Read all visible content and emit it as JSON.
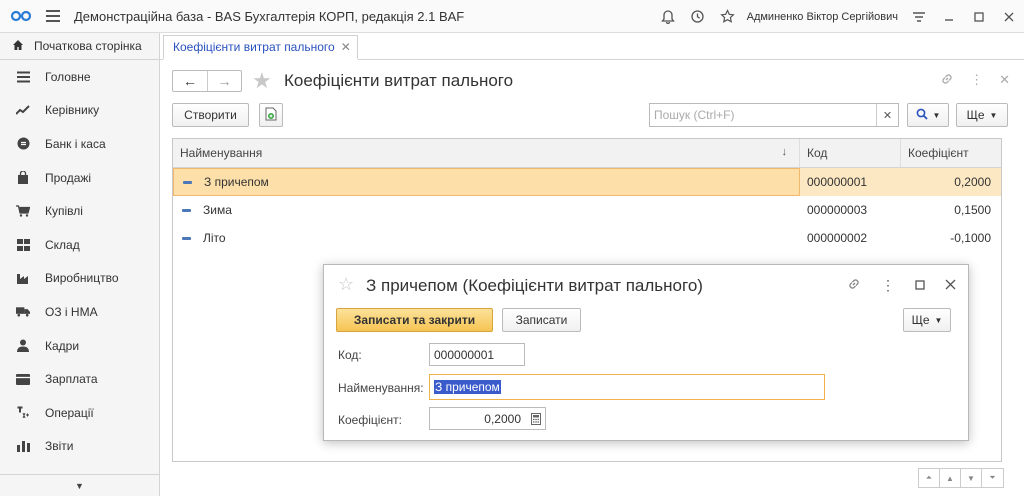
{
  "app": {
    "title": "Демонстраційна база - BAS Бухгалтерія КОРП, редакція 2.1 BAF",
    "user": "Админенко Віктор Сергійович"
  },
  "tabs": {
    "home": "Початкова сторінка",
    "active": "Коефіцієнти витрат пального"
  },
  "sidebar": {
    "items": [
      {
        "label": "Головне",
        "icon": "menu-lines-icon"
      },
      {
        "label": "Керівнику",
        "icon": "chart-trend-icon"
      },
      {
        "label": "Банк і каса",
        "icon": "coin-icon"
      },
      {
        "label": "Продажі",
        "icon": "shopping-bag-icon"
      },
      {
        "label": "Купівлі",
        "icon": "cart-icon"
      },
      {
        "label": "Склад",
        "icon": "warehouse-grid-icon"
      },
      {
        "label": "Виробництво",
        "icon": "factory-icon"
      },
      {
        "label": "ОЗ і НМА",
        "icon": "truck-icon"
      },
      {
        "label": "Кадри",
        "icon": "person-icon"
      },
      {
        "label": "Зарплата",
        "icon": "wallet-icon"
      },
      {
        "label": "Операції",
        "icon": "operations-icon"
      },
      {
        "label": "Звіти",
        "icon": "bar-chart-icon"
      }
    ]
  },
  "list": {
    "title": "Коефіцієнти витрат пального",
    "create_label": "Створити",
    "search_placeholder": "Пошук (Ctrl+F)",
    "more_label": "Ще",
    "columns": [
      "Найменування",
      "Код",
      "Коефіцієнт"
    ],
    "rows": [
      {
        "name": "З причепом",
        "code": "000000001",
        "coef": "0,2000",
        "selected": true
      },
      {
        "name": "Зима",
        "code": "000000003",
        "coef": "0,1500"
      },
      {
        "name": "Літо",
        "code": "000000002",
        "coef": "-0,1000"
      }
    ]
  },
  "dialog": {
    "title": "З причепом (Коефіцієнти витрат пального)",
    "save_close_label": "Записати та закрити",
    "save_label": "Записати",
    "more_label": "Ще",
    "code_label": "Код:",
    "code_value": "000000001",
    "name_label": "Найменування:",
    "name_value": "З причепом",
    "coef_label": "Коефіцієнт:",
    "coef_value": "0,2000"
  },
  "colors": {
    "accent": "#f6c453",
    "selection": "#fcdfa9",
    "link": "#2a52be"
  }
}
